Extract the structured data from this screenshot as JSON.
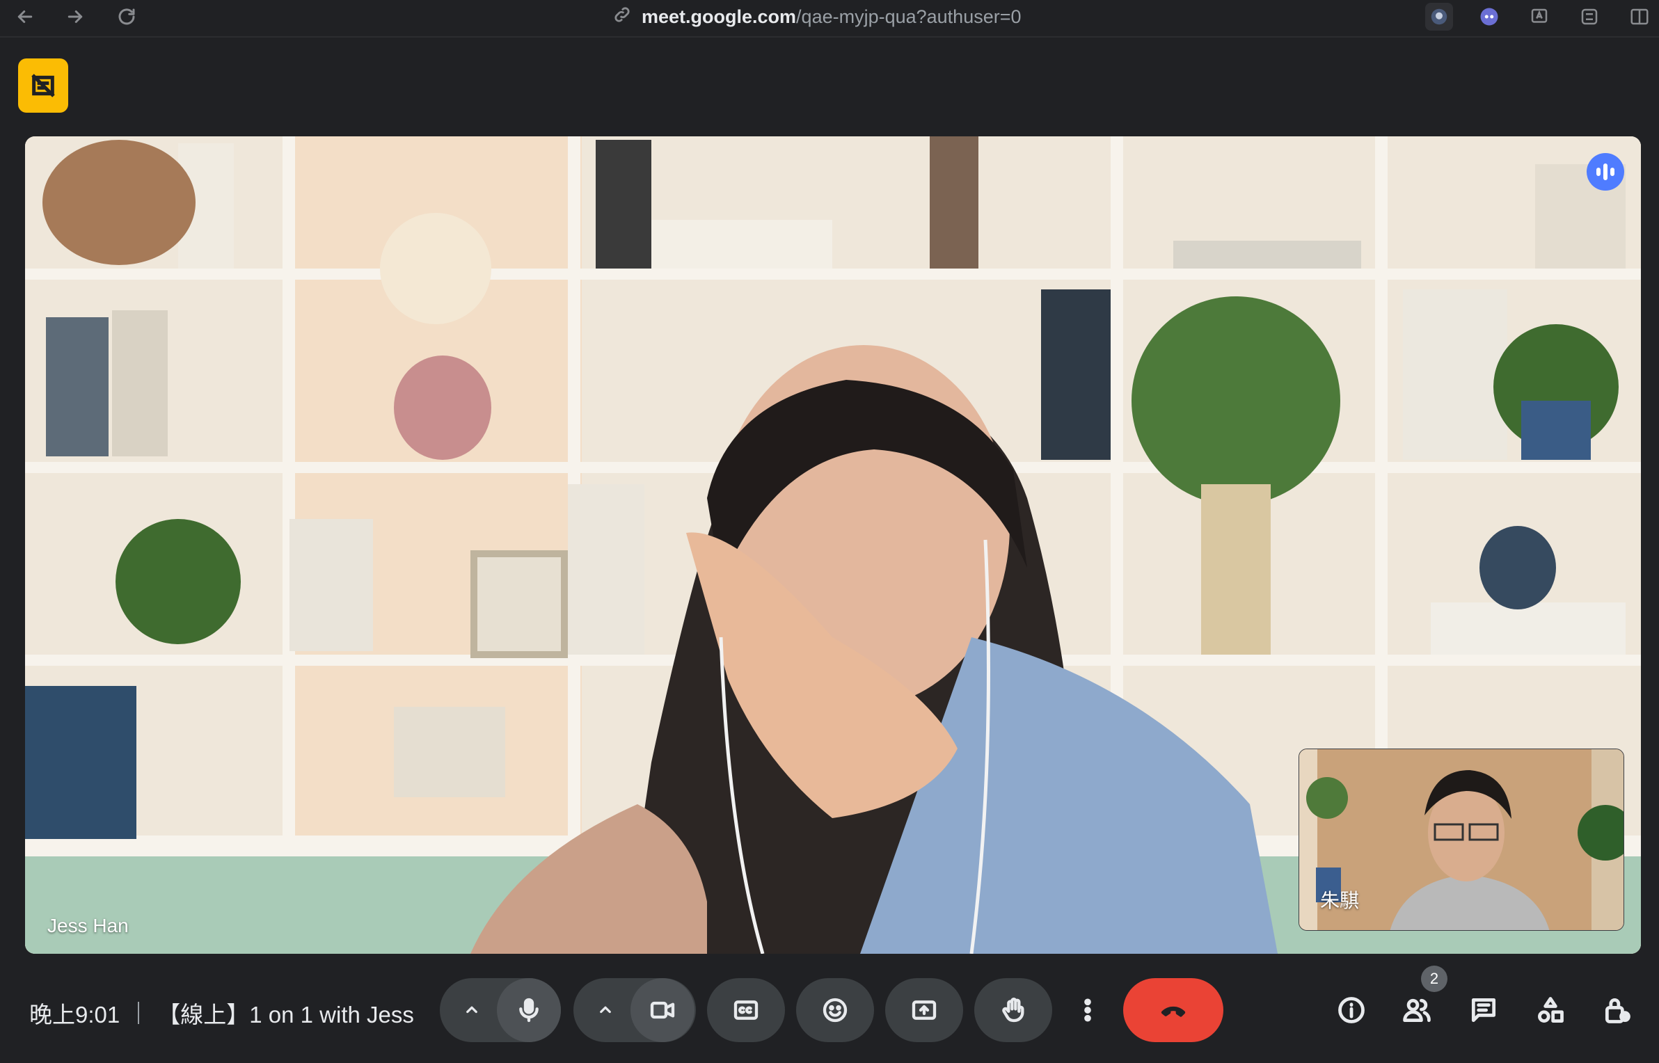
{
  "browser": {
    "url_host": "meet.google.com",
    "url_path": "/qae-myjp-qua?authuser=0"
  },
  "main_tile": {
    "participant_name": "Jess Han"
  },
  "self_tile": {
    "participant_name": "朱騏"
  },
  "meeting": {
    "time": "晚上9:01",
    "title": "【線上】1 on 1 with Jess"
  },
  "participants": {
    "count": "2"
  },
  "colors": {
    "background": "#202124",
    "control": "#3c4043",
    "hangup": "#ea4335",
    "ai_badge": "#fbbc04",
    "speaking": "#4f7cff"
  },
  "icons": {
    "back": "arrow-left-icon",
    "forward": "arrow-right-icon",
    "reload": "reload-icon",
    "link": "link-icon",
    "mic": "microphone-icon",
    "camera": "video-camera-icon",
    "captions": "closed-captions-icon",
    "reactions": "emoji-icon",
    "present": "present-screen-icon",
    "hand": "raise-hand-icon",
    "more": "more-vertical-icon",
    "end_call": "hang-up-icon",
    "info": "info-icon",
    "people": "people-icon",
    "chat": "chat-icon",
    "activities": "activities-icon",
    "host_controls": "lock-person-icon"
  }
}
